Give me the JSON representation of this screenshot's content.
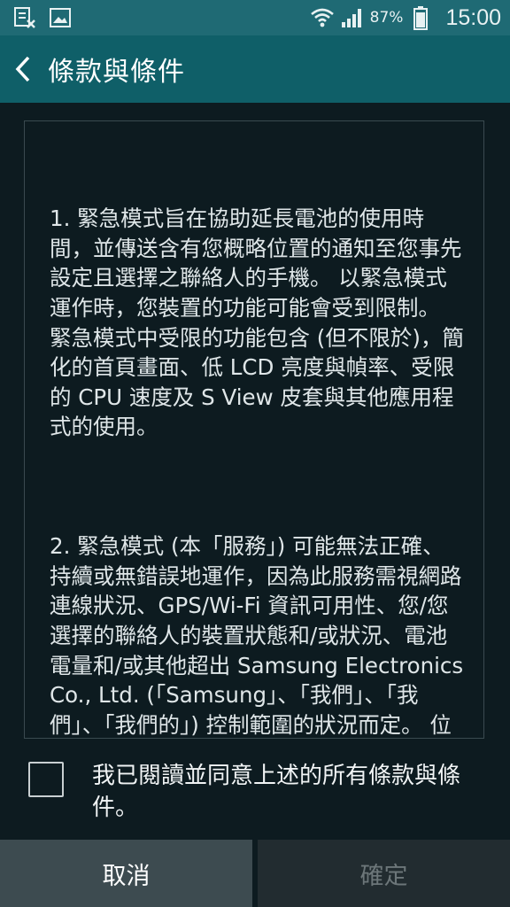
{
  "status_bar": {
    "battery_percent": "87%",
    "time": "15:00",
    "icons": [
      "notification-icon",
      "image-icon",
      "wifi-icon",
      "signal-icon",
      "battery-icon"
    ]
  },
  "action_bar": {
    "title": "條款與條件"
  },
  "terms": {
    "paragraph_1": "1. 緊急模式旨在協助延長電池的使用時間，並傳送含有您概略位置的通知至您事先設定且選擇之聯絡人的手機。 以緊急模式運作時，您裝置的功能可能會受到限制。 緊急模式中受限的功能包含 (但不限於)，簡化的首頁畫面、低 LCD 亮度與幀率、受限的 CPU 速度及 S View 皮套與其他應用程式的使用。",
    "paragraph_2": "2. 緊急模式 (本「服務」) 可能無法正確、持續或無錯誤地運作，因為此服務需視網路連線狀況、GPS/Wi-Fi 資訊可用性、您/您選擇的聯絡人的裝置狀態和/或狀況、電池電量和/或其他超出 Samsung Electronics Co., Ltd. (「Samsung」、「我們」、「我們」、「我們的」) 控制範圍的狀況而定。 位置資訊的正確性與本服務的及時傳送可能會受到您的周遭環"
  },
  "agreement": {
    "label": "我已閱讀並同意上述的所有條款與條件。",
    "checked": false
  },
  "buttons": {
    "cancel": "取消",
    "confirm": "確定"
  },
  "colors": {
    "status_bar": "#1f6a74",
    "action_bar": "#0f5f68",
    "background": "#0d1b20",
    "cancel_button": "#3d4b50",
    "confirm_button": "#222c30",
    "confirm_text_disabled": "#6c7679"
  }
}
